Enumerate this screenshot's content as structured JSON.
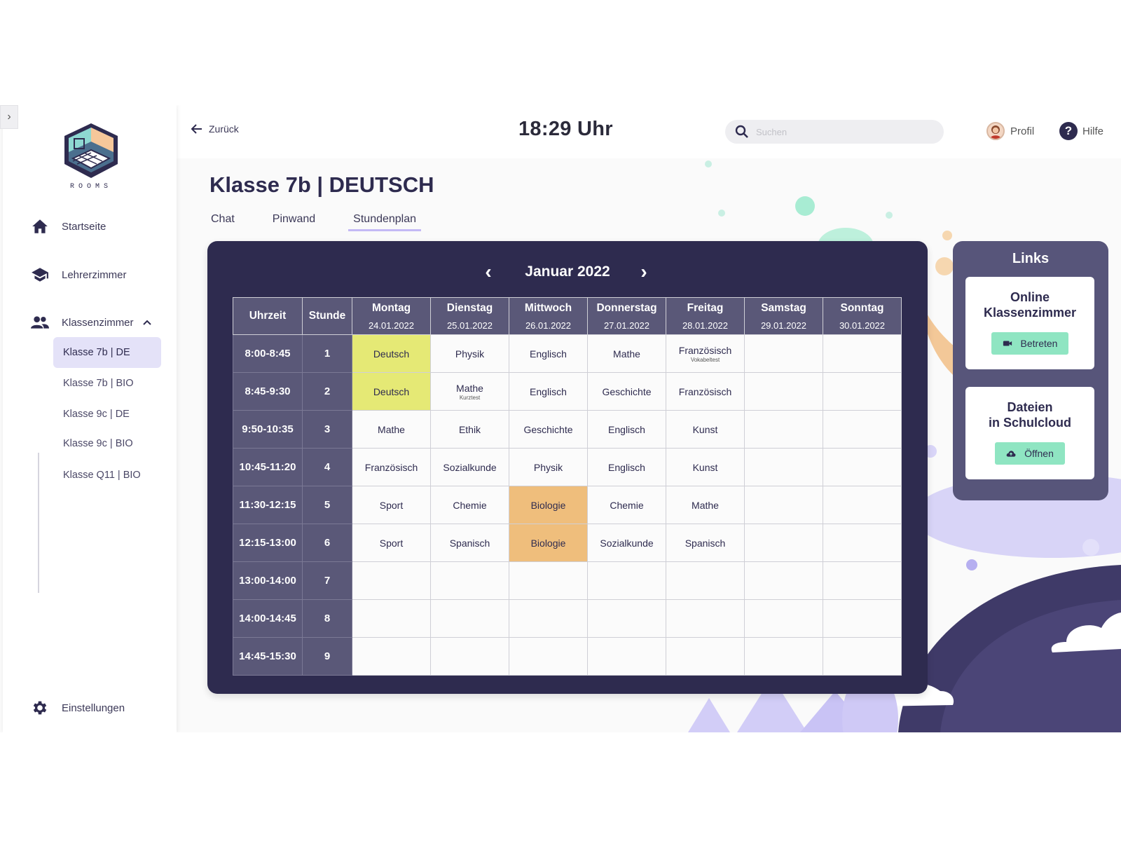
{
  "sidebar": {
    "logo_text": "ROOMS",
    "nav": [
      {
        "label": "Startseite",
        "icon": "home-icon"
      },
      {
        "label": "Lehrerzimmer",
        "icon": "graduation-cap-icon"
      },
      {
        "label": "Klassenzimmer",
        "icon": "people-icon"
      }
    ],
    "classes": [
      "Klasse 7b | DE",
      "Klasse 7b | BIO",
      "Klasse 9c | DE",
      "Klasse 9c | BIO",
      "Klasse Q11 | BIO"
    ],
    "settings_label": "Einstellungen"
  },
  "header": {
    "back_label": "Zurück",
    "clock": "18:29 Uhr",
    "search_placeholder": "Suchen",
    "profile_label": "Profil",
    "help_label": "Hilfe"
  },
  "page": {
    "title": "Klasse 7b | DEUTSCH",
    "tabs": [
      "Chat",
      "Pinwand",
      "Stundenplan"
    ],
    "active_tab": "Stundenplan"
  },
  "calendar": {
    "month": "Januar 2022",
    "headers": {
      "time": "Uhrzeit",
      "hour": "Stunde"
    },
    "days": [
      {
        "name": "Montag",
        "date": "24.01.2022"
      },
      {
        "name": "Dienstag",
        "date": "25.01.2022"
      },
      {
        "name": "Mittwoch",
        "date": "26.01.2022"
      },
      {
        "name": "Donnerstag",
        "date": "27.01.2022"
      },
      {
        "name": "Freitag",
        "date": "28.01.2022"
      },
      {
        "name": "Samstag",
        "date": "29.01.2022"
      },
      {
        "name": "Sonntag",
        "date": "30.01.2022"
      }
    ],
    "rows": [
      {
        "time": "8:00-8:45",
        "hour": "1",
        "cells": [
          {
            "text": "Deutsch",
            "highlight": "yellow"
          },
          {
            "text": "Physik"
          },
          {
            "text": "Englisch"
          },
          {
            "text": "Mathe"
          },
          {
            "text": "Französisch",
            "note": "Vokabeltest"
          },
          {
            "text": ""
          },
          {
            "text": ""
          }
        ]
      },
      {
        "time": "8:45-9:30",
        "hour": "2",
        "cells": [
          {
            "text": "Deutsch",
            "highlight": "yellow"
          },
          {
            "text": "Mathe",
            "note": "Kurztest"
          },
          {
            "text": "Englisch"
          },
          {
            "text": "Geschichte"
          },
          {
            "text": "Französisch"
          },
          {
            "text": ""
          },
          {
            "text": ""
          }
        ]
      },
      {
        "time": "9:50-10:35",
        "hour": "3",
        "cells": [
          {
            "text": "Mathe"
          },
          {
            "text": "Ethik"
          },
          {
            "text": "Geschichte"
          },
          {
            "text": "Englisch"
          },
          {
            "text": "Kunst"
          },
          {
            "text": ""
          },
          {
            "text": ""
          }
        ]
      },
      {
        "time": "10:45-11:20",
        "hour": "4",
        "cells": [
          {
            "text": "Französisch"
          },
          {
            "text": "Sozialkunde"
          },
          {
            "text": "Physik"
          },
          {
            "text": "Englisch"
          },
          {
            "text": "Kunst"
          },
          {
            "text": ""
          },
          {
            "text": ""
          }
        ]
      },
      {
        "time": "11:30-12:15",
        "hour": "5",
        "cells": [
          {
            "text": "Sport"
          },
          {
            "text": "Chemie"
          },
          {
            "text": "Biologie",
            "highlight": "orange"
          },
          {
            "text": "Chemie"
          },
          {
            "text": "Mathe"
          },
          {
            "text": ""
          },
          {
            "text": ""
          }
        ]
      },
      {
        "time": "12:15-13:00",
        "hour": "6",
        "cells": [
          {
            "text": "Sport"
          },
          {
            "text": "Spanisch"
          },
          {
            "text": "Biologie",
            "highlight": "orange"
          },
          {
            "text": "Sozialkunde"
          },
          {
            "text": "Spanisch"
          },
          {
            "text": ""
          },
          {
            "text": ""
          }
        ]
      },
      {
        "time": "13:00-14:00",
        "hour": "7",
        "cells": [
          {
            "text": ""
          },
          {
            "text": ""
          },
          {
            "text": ""
          },
          {
            "text": ""
          },
          {
            "text": ""
          },
          {
            "text": ""
          },
          {
            "text": ""
          }
        ]
      },
      {
        "time": "14:00-14:45",
        "hour": "8",
        "cells": [
          {
            "text": ""
          },
          {
            "text": ""
          },
          {
            "text": ""
          },
          {
            "text": ""
          },
          {
            "text": ""
          },
          {
            "text": ""
          },
          {
            "text": ""
          }
        ]
      },
      {
        "time": "14:45-15:30",
        "hour": "9",
        "cells": [
          {
            "text": ""
          },
          {
            "text": ""
          },
          {
            "text": ""
          },
          {
            "text": ""
          },
          {
            "text": ""
          },
          {
            "text": ""
          },
          {
            "text": ""
          }
        ]
      }
    ]
  },
  "links": {
    "title": "Links",
    "cards": [
      {
        "title_line1": "Online",
        "title_line2": "Klassenzimmer",
        "button": "Betreten",
        "icon": "video-camera-icon"
      },
      {
        "title_line1": "Dateien",
        "title_line2": "in Schulcloud",
        "button": "Öffnen",
        "icon": "cloud-upload-icon"
      }
    ]
  },
  "colors": {
    "primary_dark": "#2e2b4f",
    "header_cell": "#5a5878",
    "highlight_yellow": "#e5e975",
    "highlight_orange": "#efbe7c",
    "button_green": "#8fe5c2",
    "accent_lavender": "#c4b9f5"
  }
}
